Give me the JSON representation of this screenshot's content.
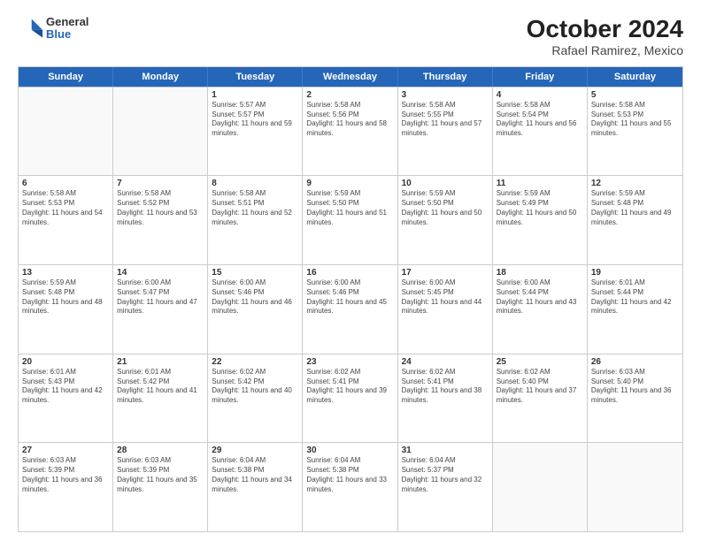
{
  "logo": {
    "general": "General",
    "blue": "Blue"
  },
  "title": "October 2024",
  "subtitle": "Rafael Ramirez, Mexico",
  "days_of_week": [
    "Sunday",
    "Monday",
    "Tuesday",
    "Wednesday",
    "Thursday",
    "Friday",
    "Saturday"
  ],
  "weeks": [
    [
      {
        "day": "",
        "sunrise": "",
        "sunset": "",
        "daylight": ""
      },
      {
        "day": "",
        "sunrise": "",
        "sunset": "",
        "daylight": ""
      },
      {
        "day": "1",
        "sunrise": "Sunrise: 5:57 AM",
        "sunset": "Sunset: 5:57 PM",
        "daylight": "Daylight: 11 hours and 59 minutes."
      },
      {
        "day": "2",
        "sunrise": "Sunrise: 5:58 AM",
        "sunset": "Sunset: 5:56 PM",
        "daylight": "Daylight: 11 hours and 58 minutes."
      },
      {
        "day": "3",
        "sunrise": "Sunrise: 5:58 AM",
        "sunset": "Sunset: 5:55 PM",
        "daylight": "Daylight: 11 hours and 57 minutes."
      },
      {
        "day": "4",
        "sunrise": "Sunrise: 5:58 AM",
        "sunset": "Sunset: 5:54 PM",
        "daylight": "Daylight: 11 hours and 56 minutes."
      },
      {
        "day": "5",
        "sunrise": "Sunrise: 5:58 AM",
        "sunset": "Sunset: 5:53 PM",
        "daylight": "Daylight: 11 hours and 55 minutes."
      }
    ],
    [
      {
        "day": "6",
        "sunrise": "Sunrise: 5:58 AM",
        "sunset": "Sunset: 5:53 PM",
        "daylight": "Daylight: 11 hours and 54 minutes."
      },
      {
        "day": "7",
        "sunrise": "Sunrise: 5:58 AM",
        "sunset": "Sunset: 5:52 PM",
        "daylight": "Daylight: 11 hours and 53 minutes."
      },
      {
        "day": "8",
        "sunrise": "Sunrise: 5:58 AM",
        "sunset": "Sunset: 5:51 PM",
        "daylight": "Daylight: 11 hours and 52 minutes."
      },
      {
        "day": "9",
        "sunrise": "Sunrise: 5:59 AM",
        "sunset": "Sunset: 5:50 PM",
        "daylight": "Daylight: 11 hours and 51 minutes."
      },
      {
        "day": "10",
        "sunrise": "Sunrise: 5:59 AM",
        "sunset": "Sunset: 5:50 PM",
        "daylight": "Daylight: 11 hours and 50 minutes."
      },
      {
        "day": "11",
        "sunrise": "Sunrise: 5:59 AM",
        "sunset": "Sunset: 5:49 PM",
        "daylight": "Daylight: 11 hours and 50 minutes."
      },
      {
        "day": "12",
        "sunrise": "Sunrise: 5:59 AM",
        "sunset": "Sunset: 5:48 PM",
        "daylight": "Daylight: 11 hours and 49 minutes."
      }
    ],
    [
      {
        "day": "13",
        "sunrise": "Sunrise: 5:59 AM",
        "sunset": "Sunset: 5:48 PM",
        "daylight": "Daylight: 11 hours and 48 minutes."
      },
      {
        "day": "14",
        "sunrise": "Sunrise: 6:00 AM",
        "sunset": "Sunset: 5:47 PM",
        "daylight": "Daylight: 11 hours and 47 minutes."
      },
      {
        "day": "15",
        "sunrise": "Sunrise: 6:00 AM",
        "sunset": "Sunset: 5:46 PM",
        "daylight": "Daylight: 11 hours and 46 minutes."
      },
      {
        "day": "16",
        "sunrise": "Sunrise: 6:00 AM",
        "sunset": "Sunset: 5:46 PM",
        "daylight": "Daylight: 11 hours and 45 minutes."
      },
      {
        "day": "17",
        "sunrise": "Sunrise: 6:00 AM",
        "sunset": "Sunset: 5:45 PM",
        "daylight": "Daylight: 11 hours and 44 minutes."
      },
      {
        "day": "18",
        "sunrise": "Sunrise: 6:00 AM",
        "sunset": "Sunset: 5:44 PM",
        "daylight": "Daylight: 11 hours and 43 minutes."
      },
      {
        "day": "19",
        "sunrise": "Sunrise: 6:01 AM",
        "sunset": "Sunset: 5:44 PM",
        "daylight": "Daylight: 11 hours and 42 minutes."
      }
    ],
    [
      {
        "day": "20",
        "sunrise": "Sunrise: 6:01 AM",
        "sunset": "Sunset: 5:43 PM",
        "daylight": "Daylight: 11 hours and 42 minutes."
      },
      {
        "day": "21",
        "sunrise": "Sunrise: 6:01 AM",
        "sunset": "Sunset: 5:42 PM",
        "daylight": "Daylight: 11 hours and 41 minutes."
      },
      {
        "day": "22",
        "sunrise": "Sunrise: 6:02 AM",
        "sunset": "Sunset: 5:42 PM",
        "daylight": "Daylight: 11 hours and 40 minutes."
      },
      {
        "day": "23",
        "sunrise": "Sunrise: 6:02 AM",
        "sunset": "Sunset: 5:41 PM",
        "daylight": "Daylight: 11 hours and 39 minutes."
      },
      {
        "day": "24",
        "sunrise": "Sunrise: 6:02 AM",
        "sunset": "Sunset: 5:41 PM",
        "daylight": "Daylight: 11 hours and 38 minutes."
      },
      {
        "day": "25",
        "sunrise": "Sunrise: 6:02 AM",
        "sunset": "Sunset: 5:40 PM",
        "daylight": "Daylight: 11 hours and 37 minutes."
      },
      {
        "day": "26",
        "sunrise": "Sunrise: 6:03 AM",
        "sunset": "Sunset: 5:40 PM",
        "daylight": "Daylight: 11 hours and 36 minutes."
      }
    ],
    [
      {
        "day": "27",
        "sunrise": "Sunrise: 6:03 AM",
        "sunset": "Sunset: 5:39 PM",
        "daylight": "Daylight: 11 hours and 36 minutes."
      },
      {
        "day": "28",
        "sunrise": "Sunrise: 6:03 AM",
        "sunset": "Sunset: 5:39 PM",
        "daylight": "Daylight: 11 hours and 35 minutes."
      },
      {
        "day": "29",
        "sunrise": "Sunrise: 6:04 AM",
        "sunset": "Sunset: 5:38 PM",
        "daylight": "Daylight: 11 hours and 34 minutes."
      },
      {
        "day": "30",
        "sunrise": "Sunrise: 6:04 AM",
        "sunset": "Sunset: 5:38 PM",
        "daylight": "Daylight: 11 hours and 33 minutes."
      },
      {
        "day": "31",
        "sunrise": "Sunrise: 6:04 AM",
        "sunset": "Sunset: 5:37 PM",
        "daylight": "Daylight: 11 hours and 32 minutes."
      },
      {
        "day": "",
        "sunrise": "",
        "sunset": "",
        "daylight": ""
      },
      {
        "day": "",
        "sunrise": "",
        "sunset": "",
        "daylight": ""
      }
    ]
  ]
}
